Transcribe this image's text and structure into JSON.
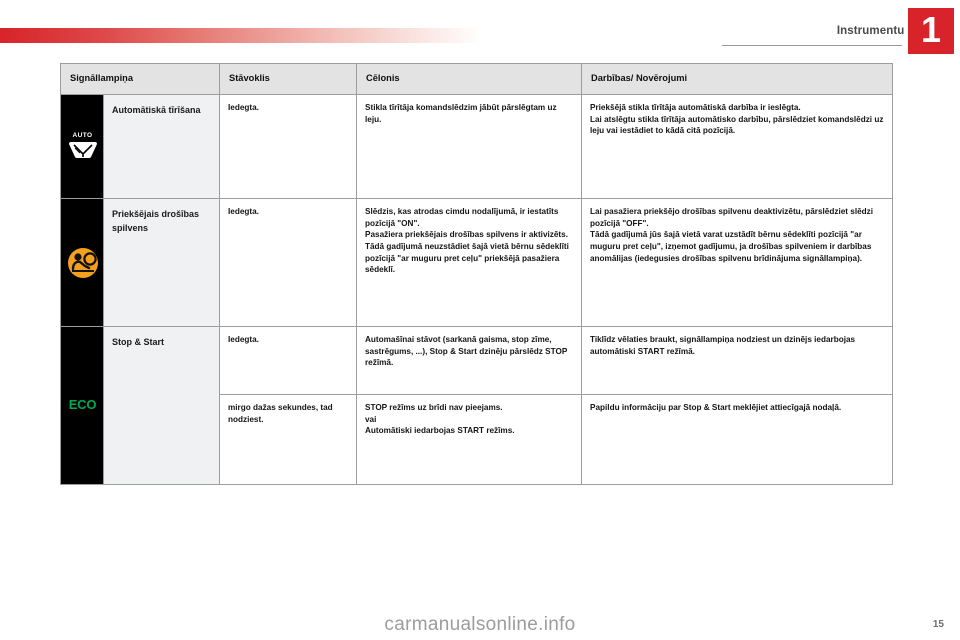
{
  "header": {
    "chapter_title": "Instrumentu panelis",
    "chapter_number": "1",
    "accent_color": "#d8232a"
  },
  "table": {
    "columns": [
      {
        "key": "indicator",
        "label": "Signāllampiņa"
      },
      {
        "key": "state",
        "label": "Stāvoklis"
      },
      {
        "key": "cause",
        "label": "Cēlonis"
      },
      {
        "key": "action",
        "label": "Darbības/ Novērojumi"
      }
    ],
    "rows": [
      {
        "icon_name": "auto-wiper-icon",
        "icon_text": "AUTO",
        "icon_color": "#ffffff",
        "icon_bg": "#000000",
        "name": "Automātiskā tīrīšana",
        "state": "Iedegta.",
        "cause": "Stikla tīrītāja komandslēdzim jābūt pārslēgtam uz leju.",
        "action": "Priekšējā stikla tīrītāja automātiskā darbība ir ieslēgta.\nLai atslēgtu stikla tīrītāja automātisko darbību, pārslēdziet komandslēdzi uz leju vai iestādiet to kādā citā pozīcijā."
      },
      {
        "icon_name": "front-airbag-icon",
        "icon_text": "",
        "icon_color": "#f2a01e",
        "icon_bg": "#000000",
        "name": "Priekšējais drošības spilvens",
        "state": "Iedegta.",
        "cause": "Slēdzis, kas atrodas cimdu nodalījumā, ir iestatīts pozīcijā \"ON\".\nPasažiera priekšējais drošības spilvens ir aktivizēts.\nTādā gadījumā neuzstādiet šajā vietā bērnu sēdeklīti pozīcijā \"ar muguru pret ceļu\" priekšējā pasažiera sēdeklī.",
        "action": "Lai pasažiera priekšējo drošības spilvenu deaktivizētu, pārslēdziet slēdzi pozīcijā \"OFF\".\nTādā gadījumā jūs šajā vietā varat uzstādīt bērnu sēdeklīti pozīcijā \"ar muguru pret ceļu\", izņemot gadījumu, ja drošības spilveniem ir darbības anomālijas (iedegusies drošības spilvenu brīdinājuma signāllampiņa)."
      },
      {
        "icon_name": "eco-stop-start-icon",
        "icon_text": "ECO",
        "icon_color": "#00a94f",
        "icon_bg": "#000000",
        "name": "Stop & Start",
        "state": "Iedegta.",
        "cause": "Automašīnai stāvot (sarkanā gaisma, stop zīme, sastrēgums, ...), Stop & Start dzinēju pārslēdz STOP režīmā.",
        "action": "Tiklīdz vēlaties braukt, signāllampiņa nodziest un dzinējs iedarbojas automātiski START režīmā."
      },
      {
        "icon_name": "",
        "icon_text": "",
        "name": "",
        "state": "mirgo dažas sekundes, tad nodziest.",
        "cause": "STOP režīms uz brīdi nav pieejams.\nvai\nAutomātiski iedarbojas START režīms.",
        "action": "Papildu informāciju par Stop & Start meklējiet attiecīgajā nodaļā."
      }
    ]
  },
  "footer": {
    "watermark": "carmanualsonline.info",
    "page_number": "15"
  }
}
